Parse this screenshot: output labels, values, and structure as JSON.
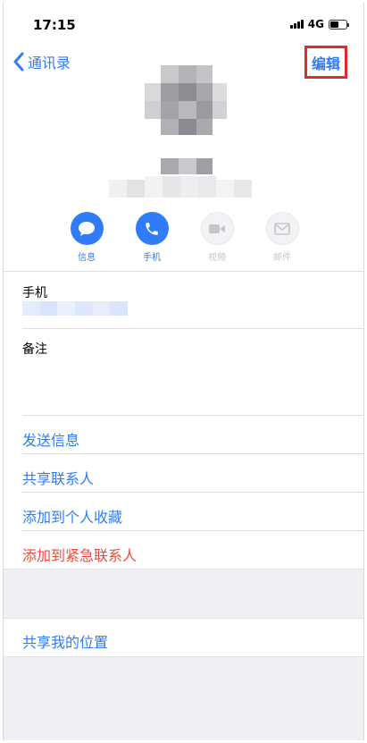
{
  "status": {
    "time": "17:15",
    "network": "4G"
  },
  "nav": {
    "back_label": "通讯录",
    "edit_label": "编辑"
  },
  "actions": [
    {
      "label": "信息",
      "icon": "message-icon",
      "enabled": true
    },
    {
      "label": "手机",
      "icon": "phone-icon",
      "enabled": true
    },
    {
      "label": "视频",
      "icon": "video-icon",
      "enabled": false
    },
    {
      "label": "邮件",
      "icon": "mail-icon",
      "enabled": false
    }
  ],
  "fields": {
    "phone_label": "手机",
    "notes_label": "备注"
  },
  "links": {
    "send_message": "发送信息",
    "share_contact": "共享联系人",
    "add_favorite": "添加到个人收藏",
    "add_emergency": "添加到紧急联系人",
    "share_location": "共享我的位置"
  },
  "colors": {
    "accent": "#2f7cf6",
    "danger": "#eb4d3d",
    "highlight_border": "#e52a2a"
  }
}
